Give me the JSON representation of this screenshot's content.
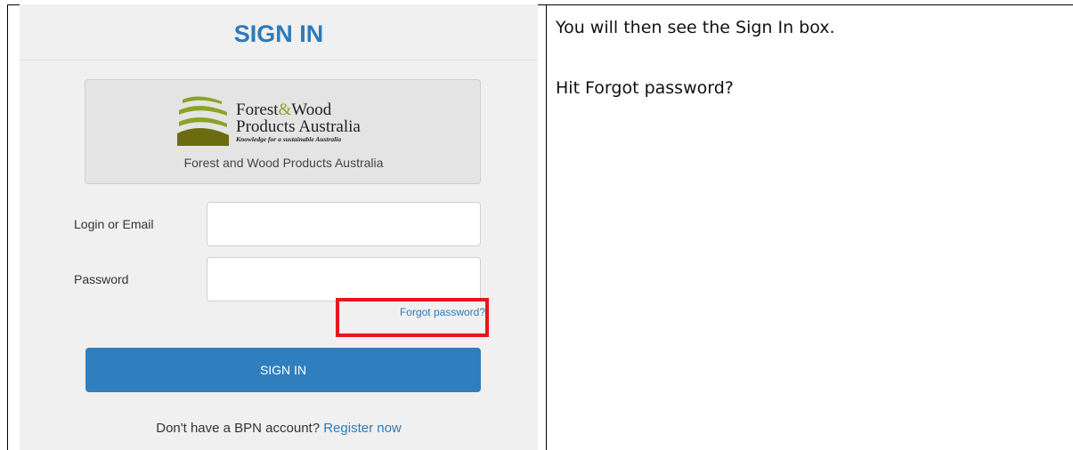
{
  "signin": {
    "title": "SIGN IN",
    "org": {
      "logo_line1_a": "Forest",
      "logo_line1_amp": "&",
      "logo_line1_b": "Wood",
      "logo_line2": "Products Australia",
      "logo_tagline": "Knowledge for a sustainable Australia",
      "name": "Forest and Wood Products Australia"
    },
    "login_label": "Login or Email",
    "login_value": "",
    "password_label": "Password",
    "password_value": "",
    "forgot_label": "Forgot password?",
    "button_label": "SIGN IN",
    "register_prompt": "Don't have a BPN account? ",
    "register_link": "Register now"
  },
  "instructions": {
    "line1": "You will then see the Sign In box.",
    "line2": "Hit Forgot password?"
  },
  "colors": {
    "accent": "#2a7bbd",
    "button": "#2f7fbe",
    "highlight": "#e8161b",
    "logo_green": "#8aa326"
  }
}
